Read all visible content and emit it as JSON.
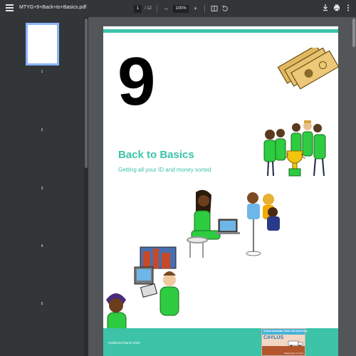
{
  "toolbar": {
    "file_name": "MTYG+9+Back+to+Basics.pdf",
    "current_page": "1",
    "page_total": "/ 12",
    "zoom": "100%",
    "zoom_out_icon": "minus-icon",
    "zoom_in_icon": "plus-icon"
  },
  "sidebar": {
    "thumbnails": [
      {
        "label": "1"
      },
      {
        "label": "2"
      },
      {
        "label": "3"
      },
      {
        "label": "4"
      },
      {
        "label": "5"
      }
    ]
  },
  "document": {
    "number": "9",
    "title": "Back to Basics",
    "subtitle": "Getting all your ID and money sorted",
    "published": "Published March 2020",
    "accent_color": "#3cc3a8",
    "logo": {
      "line1": "Central Australian Youth Link Up Service",
      "name": "CAYLUS",
      "line2": "Tangentyere Council"
    }
  }
}
